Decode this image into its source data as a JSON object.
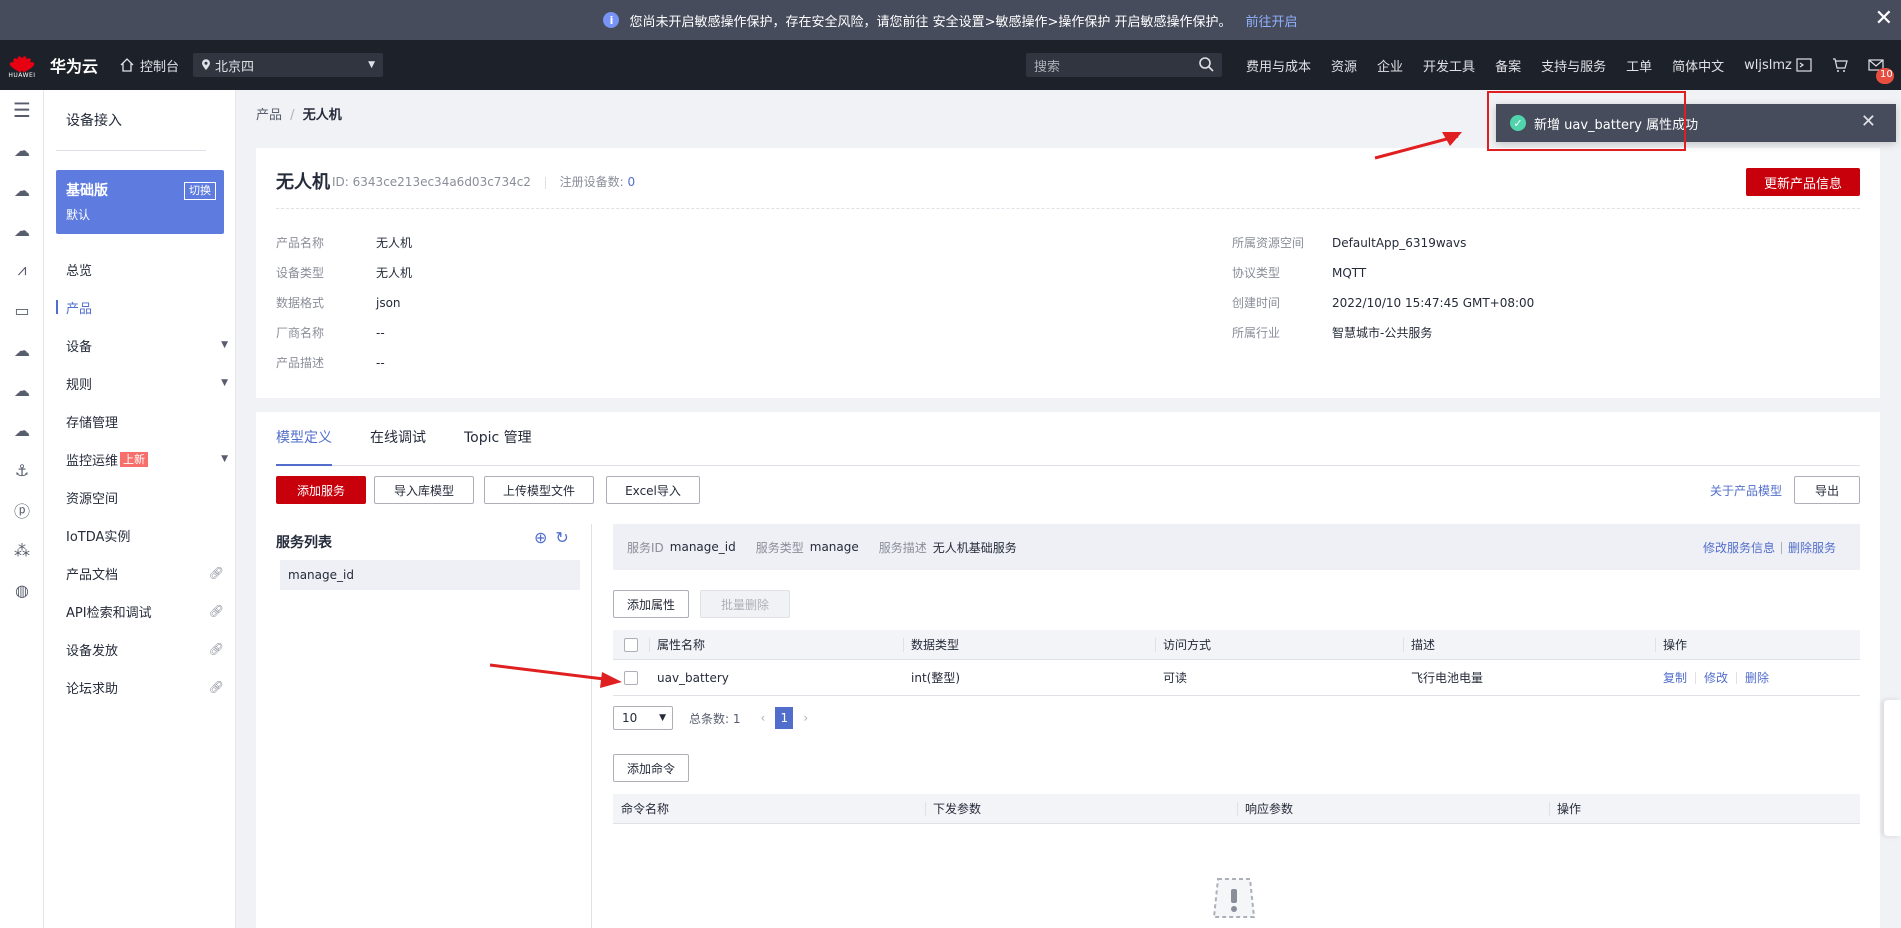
{
  "banner": {
    "message": "您尚未开启敏感操作保护，存在安全风险，请您前往 安全设置>敏感操作>操作保护 开启敏感操作保护。",
    "link": "前往开启"
  },
  "topnav": {
    "logo_text": "HUAWEI",
    "brand": "华为云",
    "console": "控制台",
    "region": "北京四",
    "search_placeholder": "搜索",
    "links": [
      "费用与成本",
      "资源",
      "企业",
      "开发工具",
      "备案",
      "支持与服务",
      "工单",
      "简体中文",
      "wljslmz"
    ],
    "message_count": "10"
  },
  "sidebar": {
    "title": "设备接入",
    "edition_name": "基础版",
    "edition_switch": "切换",
    "edition_default": "默认",
    "items": [
      {
        "label": "总览"
      },
      {
        "label": "产品"
      },
      {
        "label": "设备"
      },
      {
        "label": "规则"
      },
      {
        "label": "存储管理"
      },
      {
        "label": "监控运维",
        "badge": "上新"
      },
      {
        "label": "资源空间"
      },
      {
        "label": "IoTDA实例"
      },
      {
        "label": "产品文档"
      },
      {
        "label": "API检索和调试"
      },
      {
        "label": "设备发放"
      },
      {
        "label": "论坛求助"
      }
    ]
  },
  "breadcrumb": {
    "parent": "产品",
    "sep": "/",
    "current": "无人机"
  },
  "product": {
    "name": "无人机",
    "id_label": "ID:",
    "id": "6343ce213ec34a6d03c734c2",
    "devices_label": "注册设备数:",
    "devices": "0",
    "update_button": "更新产品信息",
    "left_fields": [
      {
        "k": "产品名称",
        "v": "无人机"
      },
      {
        "k": "设备类型",
        "v": "无人机"
      },
      {
        "k": "数据格式",
        "v": "json"
      },
      {
        "k": "厂商名称",
        "v": "--"
      },
      {
        "k": "产品描述",
        "v": "--"
      }
    ],
    "right_fields": [
      {
        "k": "所属资源空间",
        "v": "DefaultApp_6319wavs"
      },
      {
        "k": "协议类型",
        "v": "MQTT"
      },
      {
        "k": "创建时间",
        "v": "2022/10/10 15:47:45 GMT+08:00"
      },
      {
        "k": "所属行业",
        "v": "智慧城市-公共服务"
      }
    ]
  },
  "tabs": [
    "模型定义",
    "在线调试",
    "Topic 管理"
  ],
  "toolbar": {
    "add_service": "添加服务",
    "import_lib": "导入库模型",
    "upload_model": "上传模型文件",
    "excel_import": "Excel导入",
    "about_model": "关于产品模型",
    "export": "导出"
  },
  "service_list": {
    "title": "服务列表",
    "items": [
      "manage_id"
    ]
  },
  "service_info": {
    "id_label": "服务ID",
    "id": "manage_id",
    "type_label": "服务类型",
    "type": "manage",
    "desc_label": "服务描述",
    "desc": "无人机基础服务",
    "edit": "修改服务信息",
    "delete": "删除服务"
  },
  "properties": {
    "add_button": "添加属性",
    "batch_delete": "批量删除",
    "columns": [
      "属性名称",
      "数据类型",
      "访问方式",
      "描述",
      "操作"
    ],
    "rows": [
      {
        "name": "uav_battery",
        "type": "int(整型)",
        "access": "可读",
        "desc": "飞行电池电量",
        "copy": "复制",
        "edit": "修改",
        "delete": "删除"
      }
    ],
    "page_size": "10",
    "total_label": "总条数: 1",
    "current_page": "1"
  },
  "commands": {
    "add_button": "添加命令",
    "columns": [
      "命令名称",
      "下发参数",
      "响应参数",
      "操作"
    ]
  },
  "toast": {
    "message": "新增 uav_battery 属性成功"
  },
  "colors": {
    "primary": "#526ecc",
    "danger": "#c7000b",
    "topbar": "#1d2129",
    "banner": "#474c5c",
    "success": "#50d4ab"
  }
}
